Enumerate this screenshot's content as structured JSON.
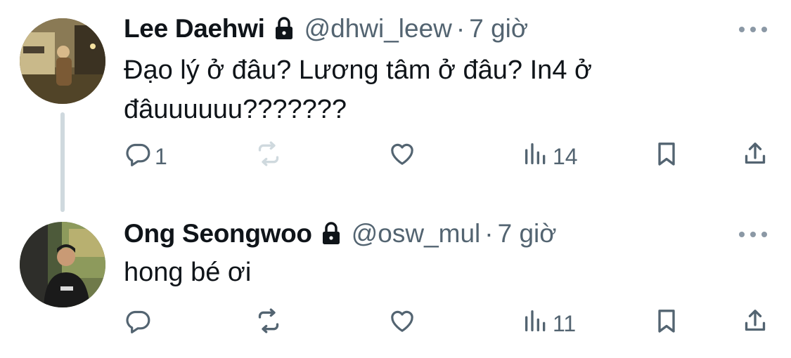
{
  "tweets": [
    {
      "name": "Lee Daehwi",
      "handle": "@dhwi_leew",
      "separator": "·",
      "time": "7 giờ",
      "text": "Đạo lý ở đâu? Lương tâm ở đâu? In4 ở đâuuuuuu???????",
      "replies": "1",
      "retweets": "",
      "likes": "",
      "views": "14"
    },
    {
      "name": "Ong Seongwoo",
      "handle": "@osw_mul",
      "separator": "·",
      "time": "7 giờ",
      "text": "hong bé ơi",
      "replies": "",
      "retweets": "",
      "likes": "",
      "views": "11"
    }
  ],
  "colors": {
    "text": "#0f1419",
    "secondary": "#536471",
    "disabled": "#cfd9de",
    "thread_line": "#cfd9de"
  },
  "icons": [
    "lock-icon",
    "more-icon",
    "reply-icon",
    "retweet-icon",
    "like-icon",
    "views-icon",
    "bookmark-icon",
    "share-icon"
  ]
}
